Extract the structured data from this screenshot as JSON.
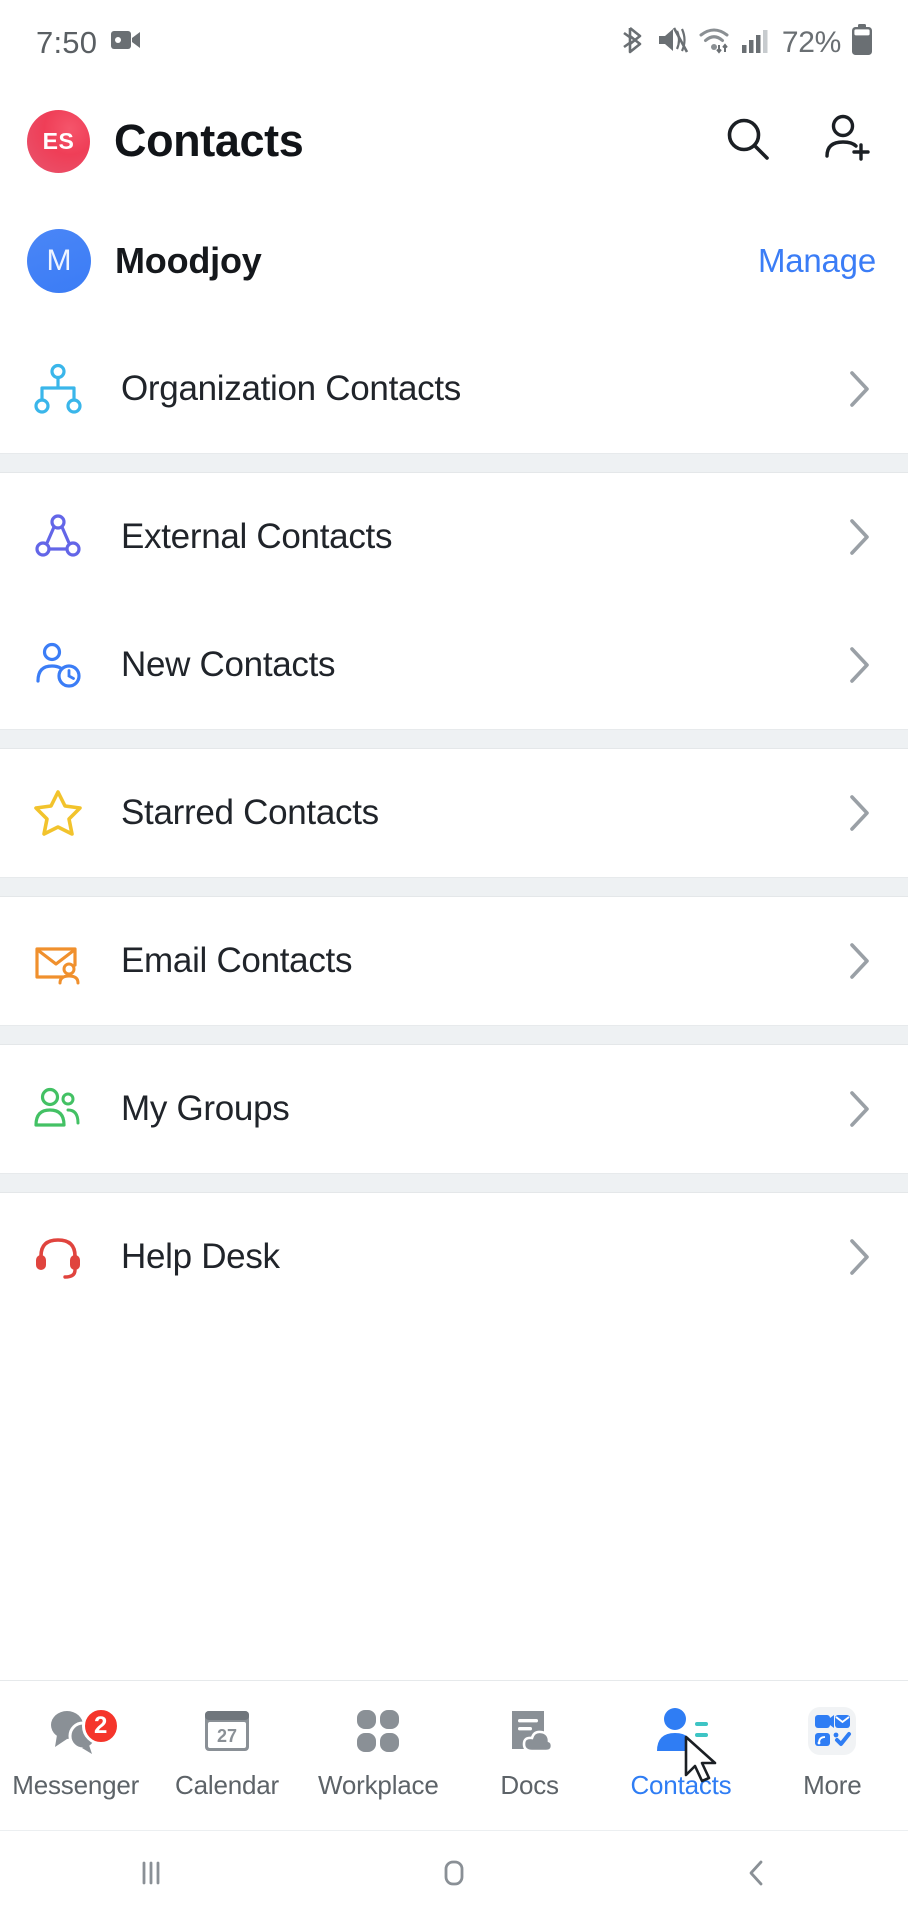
{
  "status_bar": {
    "time": "7:50",
    "battery_percent": "72%",
    "icons": [
      "video-recording-icon",
      "bluetooth-icon",
      "mute-icon",
      "wifi-icon",
      "cellular-signal-icon",
      "battery-icon"
    ]
  },
  "header": {
    "avatar_initials": "ES",
    "avatar_color": "#ef3e57",
    "title": "Contacts",
    "search_icon": "search-icon",
    "add_contact_icon": "add-person-icon"
  },
  "organization": {
    "avatar_initial": "M",
    "avatar_color": "#3b7cf5",
    "name": "Moodjoy",
    "manage_label": "Manage",
    "manage_color": "#3b7df6"
  },
  "list": {
    "groups": [
      {
        "items": [
          {
            "label": "Organization Contacts",
            "icon": "org-chart-icon",
            "color": "#3ab6ea",
            "chevron": "chevron-right-icon"
          }
        ]
      },
      {
        "items": [
          {
            "label": "External Contacts",
            "icon": "network-nodes-icon",
            "color": "#6366e8",
            "chevron": "chevron-right-icon"
          },
          {
            "label": "New Contacts",
            "icon": "person-clock-icon",
            "color": "#3b7df6",
            "chevron": "chevron-right-icon"
          }
        ]
      },
      {
        "items": [
          {
            "label": "Starred Contacts",
            "icon": "star-icon",
            "color": "#f2c32c",
            "chevron": "chevron-right-icon"
          }
        ]
      },
      {
        "items": [
          {
            "label": "Email Contacts",
            "icon": "envelope-person-icon",
            "color": "#f0902d",
            "chevron": "chevron-right-icon"
          }
        ]
      },
      {
        "items": [
          {
            "label": "My Groups",
            "icon": "people-group-icon",
            "color": "#43c164",
            "chevron": "chevron-right-icon"
          }
        ]
      },
      {
        "items": [
          {
            "label": "Help Desk",
            "icon": "headset-icon",
            "color": "#e0443e",
            "chevron": "chevron-right-icon"
          }
        ]
      }
    ]
  },
  "tabbar": {
    "active_color": "#2f7df4",
    "inactive_color": "#5d6368",
    "tabs": [
      {
        "label": "Messenger",
        "icon": "chat-bubbles-icon",
        "badge": "2",
        "active": false
      },
      {
        "label": "Calendar",
        "icon": "calendar-icon",
        "day": "27",
        "active": false
      },
      {
        "label": "Workplace",
        "icon": "grid-dots-icon",
        "active": false
      },
      {
        "label": "Docs",
        "icon": "document-cloud-icon",
        "active": false
      },
      {
        "label": "Contacts",
        "icon": "person-contact-icon",
        "active": true
      },
      {
        "label": "More",
        "icon": "app-grid-icon",
        "active": false
      }
    ]
  },
  "system_nav": {
    "recents": "recents-icon",
    "home": "home-icon",
    "back": "back-icon"
  }
}
